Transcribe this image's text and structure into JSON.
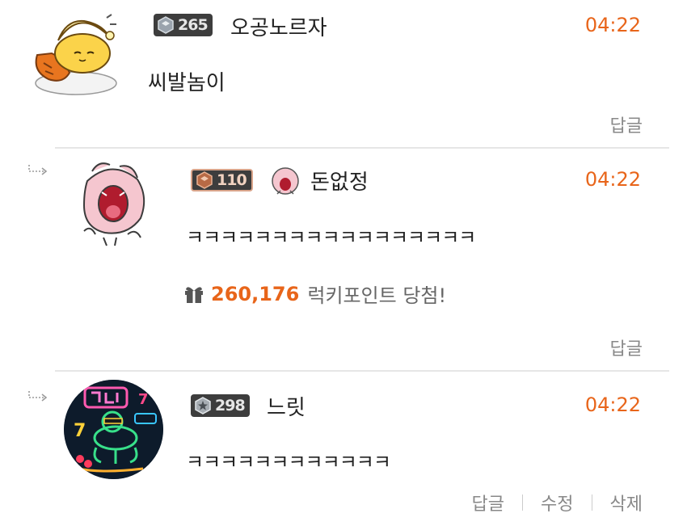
{
  "comments": [
    {
      "level": "265",
      "nickname": "오공노르자",
      "time": "04:22",
      "text": "씨발놈이",
      "actions": [
        "답글"
      ],
      "is_reply": false
    },
    {
      "level": "110",
      "nickname": "돈없정",
      "time": "04:22",
      "text": "ㅋㅋㅋㅋㅋㅋㅋㅋㅋㅋㅋㅋㅋㅋㅋㅋㅋ",
      "lucky_points": "260,176",
      "lucky_label": "럭키포인트 당첨!",
      "actions": [
        "답글"
      ],
      "is_reply": true
    },
    {
      "level": "298",
      "nickname": "느릿",
      "time": "04:22",
      "text": "ㅋㅋㅋㅋㅋㅋㅋㅋㅋㅋㅋㅋ",
      "actions": [
        "답글",
        "수정",
        "삭제"
      ],
      "is_reply": true
    }
  ],
  "colors": {
    "accent": "#e8651a",
    "muted": "#888888",
    "divider": "#e6e6e6"
  }
}
